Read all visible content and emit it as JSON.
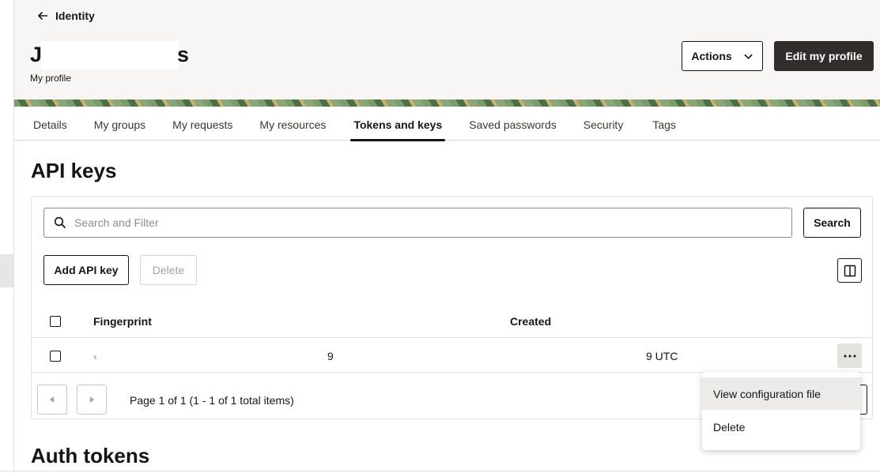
{
  "header": {
    "back_label": "Identity",
    "name_first_char": "J",
    "name_last_char": "s",
    "subtitle": "My profile",
    "actions_label": "Actions",
    "edit_label": "Edit my profile"
  },
  "tabs": [
    {
      "label": "Details",
      "active": false
    },
    {
      "label": "My groups",
      "active": false
    },
    {
      "label": "My requests",
      "active": false
    },
    {
      "label": "My resources",
      "active": false
    },
    {
      "label": "Tokens and keys",
      "active": true
    },
    {
      "label": "Saved passwords",
      "active": false
    },
    {
      "label": "Security",
      "active": false
    },
    {
      "label": "Tags",
      "active": false
    }
  ],
  "api_keys": {
    "title": "API keys",
    "search_placeholder": "Search and Filter",
    "search_button": "Search",
    "add_button": "Add API key",
    "delete_button": "Delete",
    "columns": {
      "fingerprint": "Fingerprint",
      "created": "Created"
    },
    "rows": [
      {
        "fingerprint_start": "‹",
        "fingerprint_end": "9",
        "created": "9 UTC"
      }
    ],
    "pagination_text": "Page 1 of 1 (1 - 1 of 1 total items)"
  },
  "row_menu": {
    "items": [
      "View configuration file",
      "Delete"
    ]
  },
  "auth_tokens": {
    "title": "Auth tokens"
  }
}
